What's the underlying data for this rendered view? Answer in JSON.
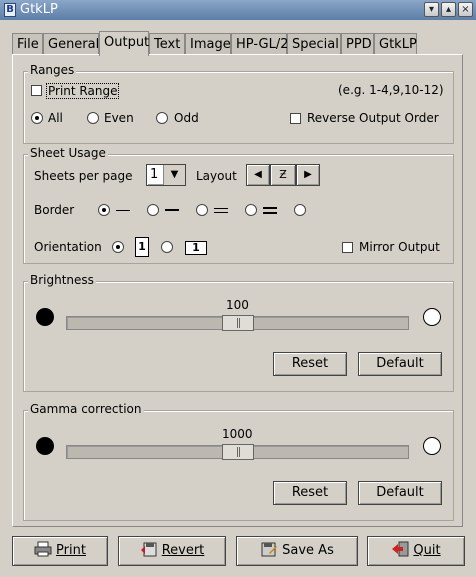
{
  "window": {
    "title": "GtkLP"
  },
  "tabs": [
    "File",
    "General",
    "Output",
    "Text",
    "Image",
    "HP-GL/2",
    "Special",
    "PPD",
    "GtkLP"
  ],
  "active_tab": "Output",
  "ranges": {
    "label": "Ranges",
    "print_range_label": "Print Range",
    "example": "(e.g. 1-4,9,10-12)",
    "all_label": "All",
    "even_label": "Even",
    "odd_label": "Odd",
    "reverse_label": "Reverse Output Order"
  },
  "sheet_usage": {
    "label": "Sheet Usage",
    "sheets_per_page_label": "Sheets per page",
    "sheets_per_page_value": "1",
    "layout_label": "Layout",
    "border_label": "Border",
    "orientation_label": "Orientation",
    "orientation_glyph": "1",
    "mirror_label": "Mirror Output"
  },
  "brightness": {
    "label": "Brightness",
    "value": "100",
    "level": 0.5,
    "reset_label": "Reset",
    "default_label": "Default"
  },
  "gamma": {
    "label": "Gamma correction",
    "value": "1000",
    "level": 0.5,
    "reset_label": "Reset",
    "default_label": "Default"
  },
  "footer": {
    "print_label": "Print",
    "revert_label": "Revert",
    "saveas_label": "Save As",
    "quit_label": "Quit"
  }
}
